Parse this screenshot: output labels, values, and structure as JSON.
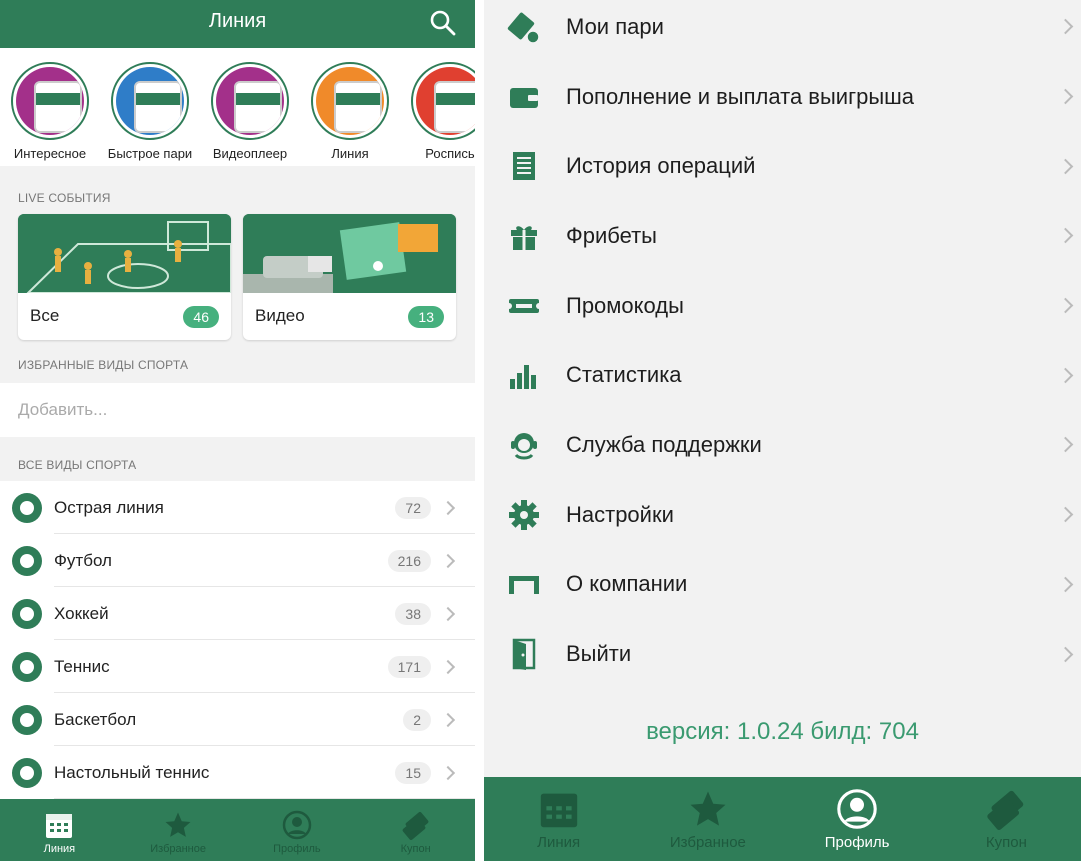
{
  "colors": {
    "brand": "#2f7d58",
    "badge": "#46b07e",
    "version": "#3a9a70"
  },
  "left": {
    "header": {
      "title": "Линия"
    },
    "stories": [
      {
        "label": "Интересное",
        "color": "#a3308a"
      },
      {
        "label": "Быстрое пари",
        "color": "#2f7dc8"
      },
      {
        "label": "Видеоплеер",
        "color": "#a3308a"
      },
      {
        "label": "Линия",
        "color": "#f08a2a"
      },
      {
        "label": "Роспись",
        "color": "#e04030"
      }
    ],
    "live_section_title": "LIVE СОБЫТИЯ",
    "live_cards": [
      {
        "label": "Все",
        "count": "46"
      },
      {
        "label": "Видео",
        "count": "13"
      }
    ],
    "favorites_section_title": "ИЗБРАННЫЕ ВИДЫ СПОРТА",
    "add_placeholder": "Добавить...",
    "all_sports_title": "ВСЕ ВИДЫ СПОРТА",
    "sports": [
      {
        "name": "Острая линия",
        "count": "72"
      },
      {
        "name": "Футбол",
        "count": "216"
      },
      {
        "name": "Хоккей",
        "count": "38"
      },
      {
        "name": "Теннис",
        "count": "171"
      },
      {
        "name": "Баскетбол",
        "count": "2"
      },
      {
        "name": "Настольный теннис",
        "count": "15"
      }
    ],
    "tabs": [
      {
        "label": "Линия",
        "icon": "calendar-icon",
        "active": true
      },
      {
        "label": "Избранное",
        "icon": "star-icon",
        "active": false
      },
      {
        "label": "Профиль",
        "icon": "profile-icon",
        "active": false
      },
      {
        "label": "Купон",
        "icon": "coupon-icon",
        "active": false
      }
    ]
  },
  "right": {
    "menu": [
      {
        "label": "Мои пари",
        "icon": "bets-icon"
      },
      {
        "label": "Пополнение и выплата выигрыша",
        "icon": "wallet-icon"
      },
      {
        "label": "История операций",
        "icon": "history-icon"
      },
      {
        "label": "Фрибеты",
        "icon": "gift-icon"
      },
      {
        "label": "Промокоды",
        "icon": "promo-icon"
      },
      {
        "label": "Статистика",
        "icon": "stats-icon"
      },
      {
        "label": "Служба поддержки",
        "icon": "support-icon"
      },
      {
        "label": "Настройки",
        "icon": "gear-icon"
      },
      {
        "label": "О компании",
        "icon": "company-icon"
      },
      {
        "label": "Выйти",
        "icon": "logout-icon"
      }
    ],
    "version": "версия: 1.0.24 билд: 704",
    "tabs": [
      {
        "label": "Линия",
        "icon": "calendar-icon",
        "active": false
      },
      {
        "label": "Избранное",
        "icon": "star-icon",
        "active": false
      },
      {
        "label": "Профиль",
        "icon": "profile-icon",
        "active": true
      },
      {
        "label": "Купон",
        "icon": "coupon-icon",
        "active": false
      }
    ]
  }
}
